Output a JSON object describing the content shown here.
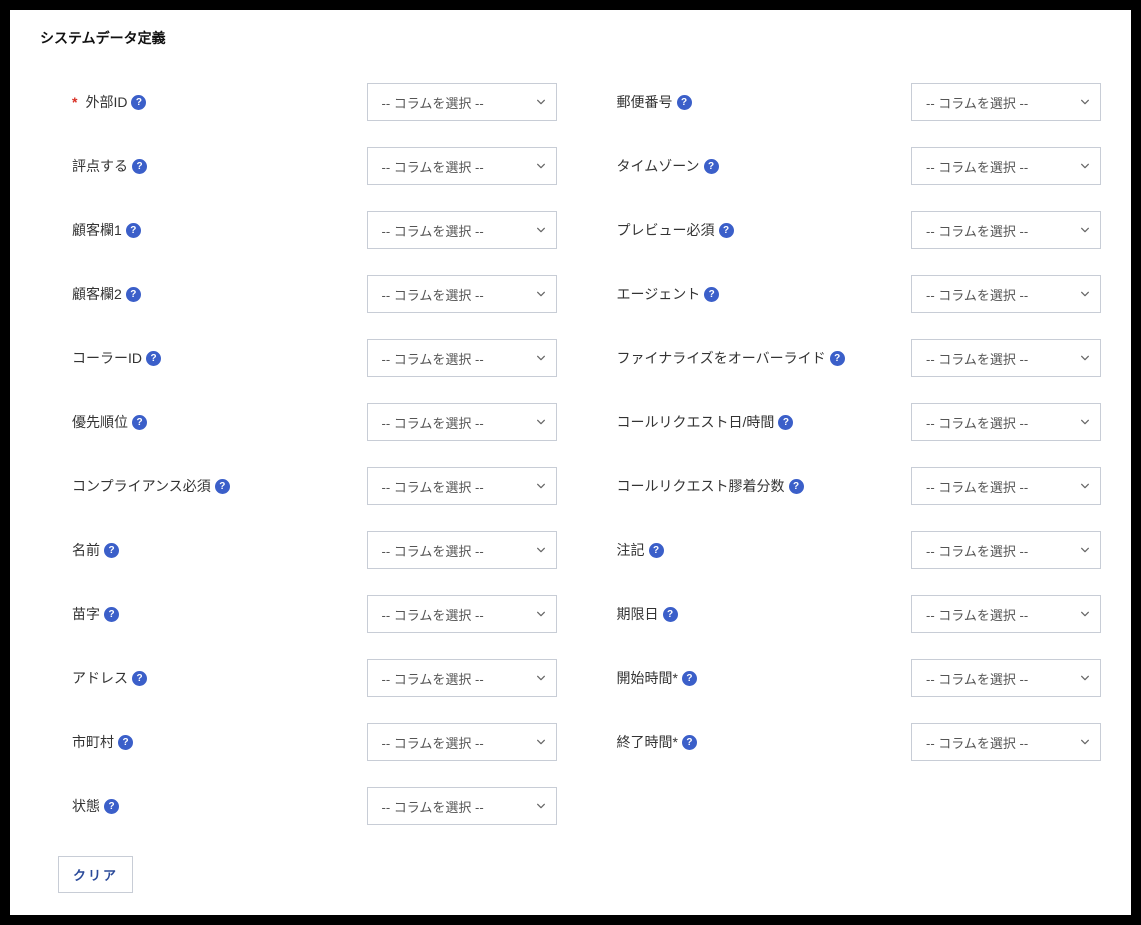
{
  "section_title": "システムデータ定義",
  "select_placeholder": "-- コラムを選択 --",
  "clear_button_label": "クリア",
  "left_fields": [
    {
      "key": "external-id",
      "label": "外部ID",
      "required": true,
      "help": true
    },
    {
      "key": "rate",
      "label": "評点する",
      "required": false,
      "help": true
    },
    {
      "key": "customer-field-1",
      "label": "顧客欄1",
      "required": false,
      "help": true
    },
    {
      "key": "customer-field-2",
      "label": "顧客欄2",
      "required": false,
      "help": true
    },
    {
      "key": "caller-id",
      "label": "コーラーID",
      "required": false,
      "help": true
    },
    {
      "key": "priority",
      "label": "優先順位",
      "required": false,
      "help": true
    },
    {
      "key": "compliance-required",
      "label": "コンプライアンス必須",
      "required": false,
      "help": true
    },
    {
      "key": "first-name",
      "label": "名前",
      "required": false,
      "help": true
    },
    {
      "key": "last-name",
      "label": "苗字",
      "required": false,
      "help": true
    },
    {
      "key": "address",
      "label": "アドレス",
      "required": false,
      "help": true
    },
    {
      "key": "city",
      "label": "市町村",
      "required": false,
      "help": true
    },
    {
      "key": "state",
      "label": "状態",
      "required": false,
      "help": true
    }
  ],
  "right_fields": [
    {
      "key": "postal-code",
      "label": "郵便番号",
      "required": false,
      "help": true
    },
    {
      "key": "timezone",
      "label": "タイムゾーン",
      "required": false,
      "help": true
    },
    {
      "key": "preview-required",
      "label": "プレビュー必須",
      "required": false,
      "help": true
    },
    {
      "key": "agent",
      "label": "エージェント",
      "required": false,
      "help": true
    },
    {
      "key": "override-finalize",
      "label": "ファイナライズをオーバーライド",
      "required": false,
      "help": true
    },
    {
      "key": "call-request-datetime",
      "label": "コールリクエスト日/時間",
      "required": false,
      "help": true
    },
    {
      "key": "call-request-adhesion-minutes",
      "label": "コールリクエスト膠着分数",
      "required": false,
      "help": true
    },
    {
      "key": "notes",
      "label": "注記",
      "required": false,
      "help": true
    },
    {
      "key": "due-date",
      "label": "期限日",
      "required": false,
      "help": true
    },
    {
      "key": "start-time",
      "label": "開始時間*",
      "required": false,
      "help": true
    },
    {
      "key": "end-time",
      "label": "終了時間*",
      "required": false,
      "help": true
    }
  ]
}
